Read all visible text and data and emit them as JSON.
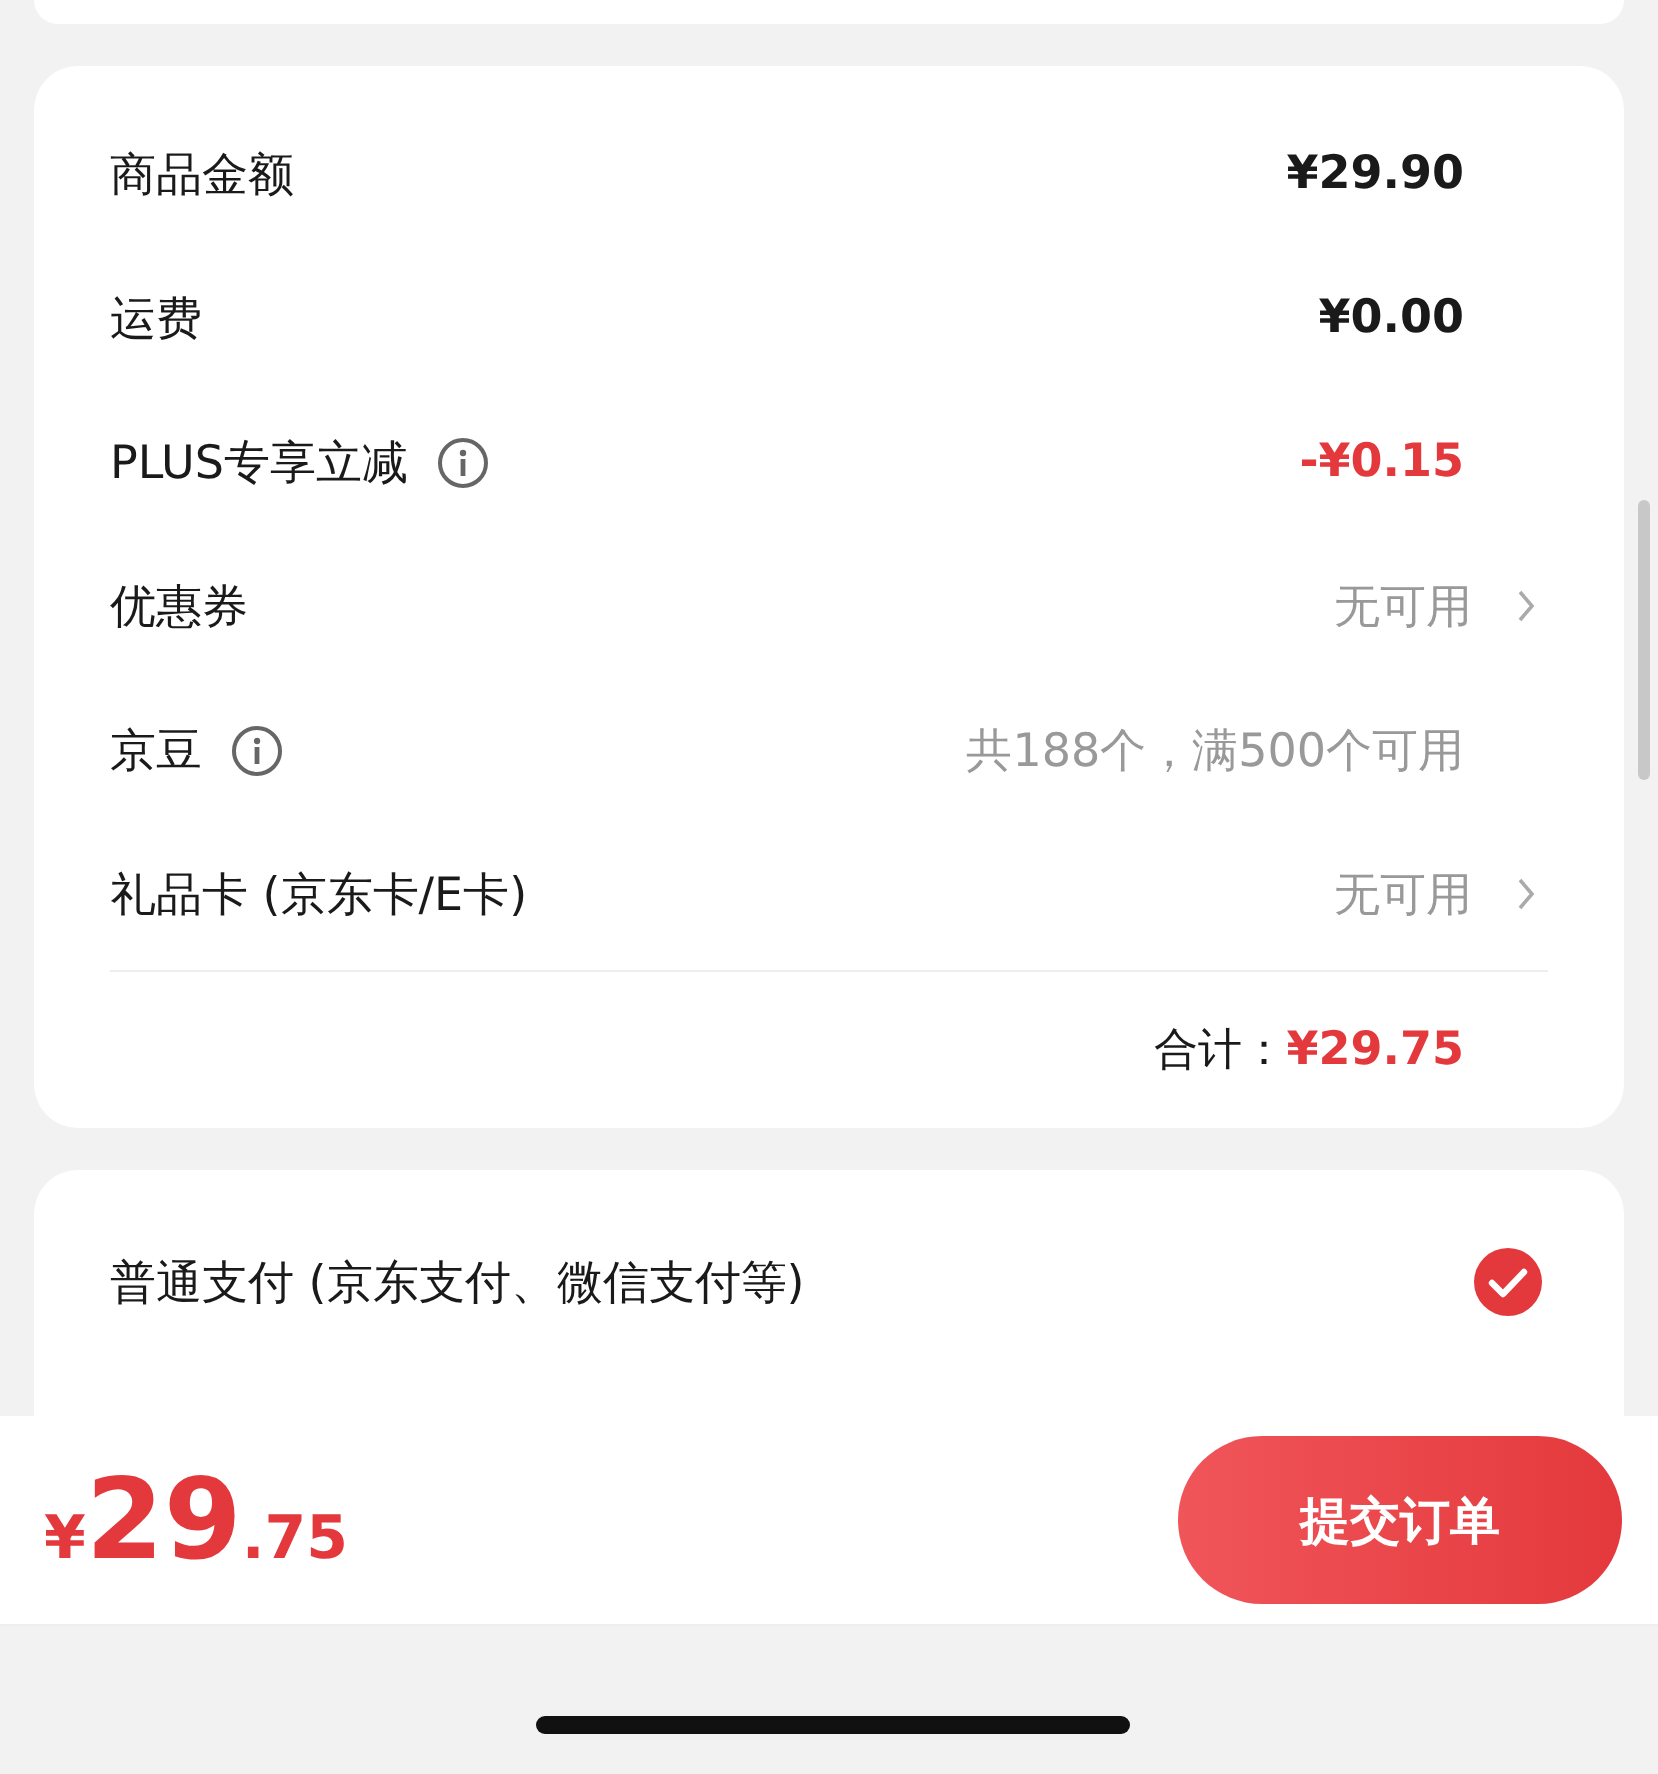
{
  "summary": {
    "rows": [
      {
        "label": "商品金额",
        "value": "¥29.90",
        "kind": "amount",
        "info": false,
        "chevron": false
      },
      {
        "label": "运费",
        "value": "¥0.00",
        "kind": "amount",
        "info": false,
        "chevron": false
      },
      {
        "label": "PLUS专享立减",
        "value": "-¥0.15",
        "kind": "discount",
        "info": true,
        "chevron": false
      },
      {
        "label": "优惠券",
        "value": "无可用",
        "kind": "muted",
        "info": false,
        "chevron": true
      },
      {
        "label": "京豆",
        "value": "共188个，满500个可用",
        "kind": "muted",
        "info": true,
        "chevron": false
      },
      {
        "label": "礼品卡 (京东卡/E卡)",
        "value": "无可用",
        "kind": "muted",
        "info": false,
        "chevron": true
      }
    ],
    "total": {
      "label": "合计：",
      "value": "¥29.75"
    }
  },
  "payment": [
    {
      "label": "普通支付 (京东支付、微信支付等)",
      "selected": true
    }
  ],
  "footer": {
    "currency": "¥",
    "integer": "29",
    "decimals": ".75",
    "submit": "提交订单"
  }
}
